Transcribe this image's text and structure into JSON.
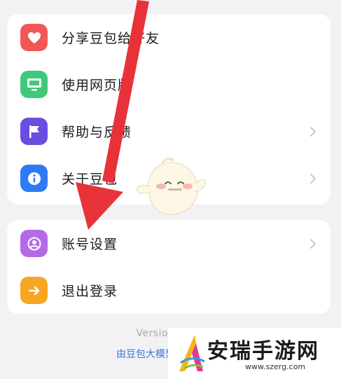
{
  "menu_primary": [
    {
      "label": "分享豆包给好友",
      "icon": "heart-icon",
      "icon_bg": "#f25757",
      "chevron": false
    },
    {
      "label": "使用网页版",
      "icon": "monitor-icon",
      "icon_bg": "#3fc97a",
      "chevron": false
    },
    {
      "label": "帮助与反馈",
      "icon": "flag-icon",
      "icon_bg": "#6a4de0",
      "chevron": true
    },
    {
      "label": "关于豆包",
      "icon": "info-icon",
      "icon_bg": "#2f7bf5",
      "chevron": true
    }
  ],
  "menu_account": [
    {
      "label": "账号设置",
      "icon": "user-circle-icon",
      "icon_bg": "#b46ae6",
      "chevron": true
    },
    {
      "label": "退出登录",
      "icon": "arrow-right-icon",
      "icon_bg": "#f7a623",
      "chevron": false
    }
  ],
  "footer": {
    "version": "Version 5.1.0",
    "model_link": "由豆包大模型"
  },
  "watermark": {
    "title": "安瑞手游网",
    "url": "www.szerg.com"
  },
  "colors": {
    "background": "#f2f2f5",
    "card": "#ffffff",
    "annotation_arrow": "#e8323a",
    "link": "#3b74d6"
  }
}
